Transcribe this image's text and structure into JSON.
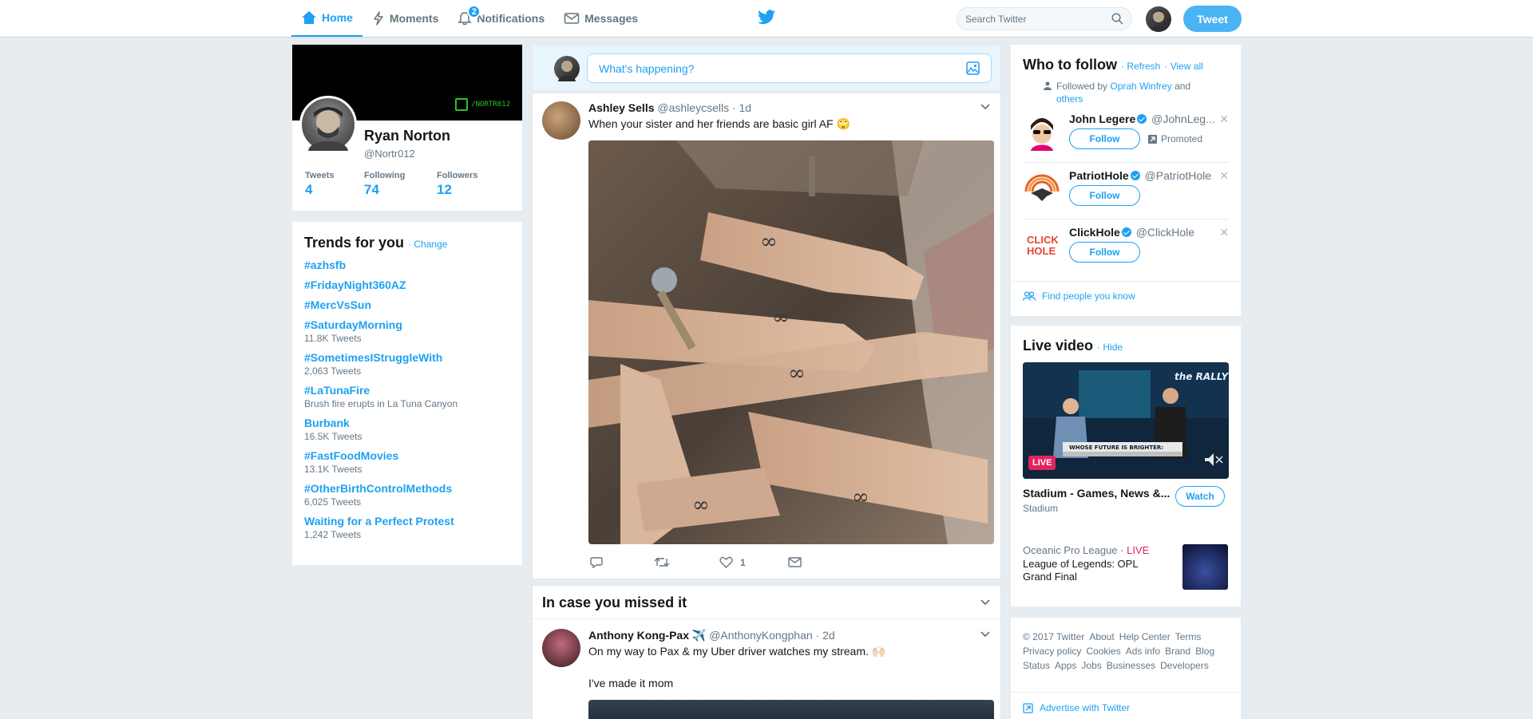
{
  "nav": {
    "home": "Home",
    "moments": "Moments",
    "notifications": "Notifications",
    "notifications_count": "2",
    "messages": "Messages"
  },
  "search": {
    "placeholder": "Search Twitter"
  },
  "tweet_button": "Tweet",
  "profile": {
    "name": "Ryan Norton",
    "handle": "@Nortr012",
    "banner_tag": "/NORTR012",
    "stats": [
      {
        "label": "Tweets",
        "value": "4"
      },
      {
        "label": "Following",
        "value": "74"
      },
      {
        "label": "Followers",
        "value": "12"
      }
    ]
  },
  "trends": {
    "title": "Trends for you",
    "change": "Change",
    "items": [
      {
        "name": "#azhsfb",
        "sub": ""
      },
      {
        "name": "#FridayNight360AZ",
        "sub": ""
      },
      {
        "name": "#MercVsSun",
        "sub": ""
      },
      {
        "name": "#SaturdayMorning",
        "sub": "11.8K Tweets"
      },
      {
        "name": "#SometimesIStruggleWith",
        "sub": "2,063 Tweets"
      },
      {
        "name": "#LaTunaFire",
        "sub": "Brush fire erupts in La Tuna Canyon"
      },
      {
        "name": "Burbank",
        "sub": "16.5K Tweets"
      },
      {
        "name": "#FastFoodMovies",
        "sub": "13.1K Tweets"
      },
      {
        "name": "#OtherBirthControlMethods",
        "sub": "6,025 Tweets"
      },
      {
        "name": "Waiting for a Perfect Protest",
        "sub": "1,242 Tweets"
      }
    ]
  },
  "compose": {
    "placeholder": "What's happening?"
  },
  "tweet": {
    "name": "Ashley Sells",
    "handle": "@ashleycsells",
    "time": "· 1d",
    "text": "When your sister and her friends are basic girl AF 🙄",
    "likes": "1"
  },
  "missed": {
    "title": "In case you missed it",
    "name": "Anthony Kong-Pax ✈️",
    "handle": "@AnthonyKongphan",
    "time": "· 2d",
    "text": "On my way to Pax & my Uber driver watches my stream. 🙌🏻",
    "text2": "I've made it mom"
  },
  "who_to_follow": {
    "title": "Who to follow",
    "refresh": "· Refresh",
    "view_all": "· View all",
    "followed_prefix": "Followed by",
    "followed_name": "Oprah Winfrey",
    "followed_and": "and",
    "followed_others": "others",
    "follow_label": "Follow",
    "promoted": "Promoted",
    "suggestions": [
      {
        "name": "John Legere",
        "handle": "@JohnLeg..."
      },
      {
        "name": "PatriotHole",
        "handle": "@PatriotHole"
      },
      {
        "name": "ClickHole",
        "handle": "@ClickHole"
      }
    ],
    "find_people": "Find people you know"
  },
  "live_video": {
    "title": "Live video",
    "hide": "· Hide",
    "live_badge": "LIVE",
    "banner_text": "WHOSE FUTURE IS BRIGHTER:",
    "show_logo": "the RALLY",
    "stream_name": "Stadium - Games, News &...",
    "stream_sub": "Stadium",
    "watch": "Watch",
    "event_league": "Oceanic Pro League",
    "event_live": "· LIVE",
    "event_title": "League of Legends: OPL Grand Final"
  },
  "footer": {
    "links": [
      "© 2017 Twitter",
      "About",
      "Help Center",
      "Terms",
      "Privacy policy",
      "Cookies",
      "Ads info",
      "Brand",
      "Blog",
      "Status",
      "Apps",
      "Jobs",
      "Businesses",
      "Developers"
    ],
    "advertise": "Advertise with Twitter"
  },
  "colors": {
    "accent": "#1da1f2",
    "live": "#e0245e",
    "background": "#e6ecf0"
  }
}
